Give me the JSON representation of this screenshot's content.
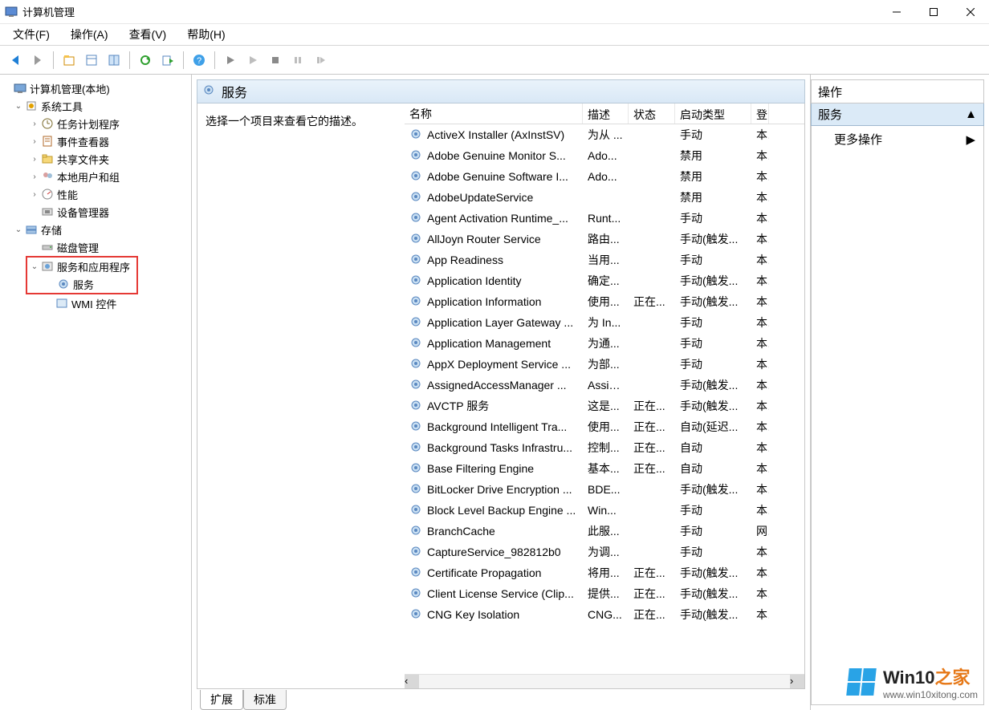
{
  "window": {
    "title": "计算机管理"
  },
  "menu": {
    "file": "文件(F)",
    "action": "操作(A)",
    "view": "查看(V)",
    "help": "帮助(H)"
  },
  "tree": {
    "root": "计算机管理(本地)",
    "system_tools": "系统工具",
    "task_scheduler": "任务计划程序",
    "event_viewer": "事件查看器",
    "shared_folders": "共享文件夹",
    "local_users": "本地用户和组",
    "performance": "性能",
    "device_manager": "设备管理器",
    "storage": "存储",
    "disk_mgmt": "磁盘管理",
    "services_apps": "服务和应用程序",
    "services": "服务",
    "wmi": "WMI 控件"
  },
  "center": {
    "header": "服务",
    "description_prompt": "选择一个项目来查看它的描述。",
    "columns": {
      "name": "名称",
      "desc": "描述",
      "state": "状态",
      "startup": "启动类型",
      "logon": "登"
    },
    "tabs": {
      "extended": "扩展",
      "standard": "标准"
    }
  },
  "services": [
    {
      "name": "ActiveX Installer (AxInstSV)",
      "desc": "为从 ...",
      "state": "",
      "startup": "手动",
      "logon": "本"
    },
    {
      "name": "Adobe Genuine Monitor S...",
      "desc": "Ado...",
      "state": "",
      "startup": "禁用",
      "logon": "本"
    },
    {
      "name": "Adobe Genuine Software I...",
      "desc": "Ado...",
      "state": "",
      "startup": "禁用",
      "logon": "本"
    },
    {
      "name": "AdobeUpdateService",
      "desc": "",
      "state": "",
      "startup": "禁用",
      "logon": "本"
    },
    {
      "name": "Agent Activation Runtime_...",
      "desc": "Runt...",
      "state": "",
      "startup": "手动",
      "logon": "本"
    },
    {
      "name": "AllJoyn Router Service",
      "desc": "路由...",
      "state": "",
      "startup": "手动(触发...",
      "logon": "本"
    },
    {
      "name": "App Readiness",
      "desc": "当用...",
      "state": "",
      "startup": "手动",
      "logon": "本"
    },
    {
      "name": "Application Identity",
      "desc": "确定...",
      "state": "",
      "startup": "手动(触发...",
      "logon": "本"
    },
    {
      "name": "Application Information",
      "desc": "使用...",
      "state": "正在...",
      "startup": "手动(触发...",
      "logon": "本"
    },
    {
      "name": "Application Layer Gateway ...",
      "desc": "为 In...",
      "state": "",
      "startup": "手动",
      "logon": "本"
    },
    {
      "name": "Application Management",
      "desc": "为通...",
      "state": "",
      "startup": "手动",
      "logon": "本"
    },
    {
      "name": "AppX Deployment Service ...",
      "desc": "为部...",
      "state": "",
      "startup": "手动",
      "logon": "本"
    },
    {
      "name": "AssignedAccessManager ...",
      "desc": "Assig...",
      "state": "",
      "startup": "手动(触发...",
      "logon": "本"
    },
    {
      "name": "AVCTP 服务",
      "desc": "这是...",
      "state": "正在...",
      "startup": "手动(触发...",
      "logon": "本"
    },
    {
      "name": "Background Intelligent Tra...",
      "desc": "使用...",
      "state": "正在...",
      "startup": "自动(延迟...",
      "logon": "本"
    },
    {
      "name": "Background Tasks Infrastru...",
      "desc": "控制...",
      "state": "正在...",
      "startup": "自动",
      "logon": "本"
    },
    {
      "name": "Base Filtering Engine",
      "desc": "基本...",
      "state": "正在...",
      "startup": "自动",
      "logon": "本"
    },
    {
      "name": "BitLocker Drive Encryption ...",
      "desc": "BDE...",
      "state": "",
      "startup": "手动(触发...",
      "logon": "本"
    },
    {
      "name": "Block Level Backup Engine ...",
      "desc": "Win...",
      "state": "",
      "startup": "手动",
      "logon": "本"
    },
    {
      "name": "BranchCache",
      "desc": "此服...",
      "state": "",
      "startup": "手动",
      "logon": "网"
    },
    {
      "name": "CaptureService_982812b0",
      "desc": "为调...",
      "state": "",
      "startup": "手动",
      "logon": "本"
    },
    {
      "name": "Certificate Propagation",
      "desc": "将用...",
      "state": "正在...",
      "startup": "手动(触发...",
      "logon": "本"
    },
    {
      "name": "Client License Service (Clip...",
      "desc": "提供...",
      "state": "正在...",
      "startup": "手动(触发...",
      "logon": "本"
    },
    {
      "name": "CNG Key Isolation",
      "desc": "CNG...",
      "state": "正在...",
      "startup": "手动(触发...",
      "logon": "本"
    }
  ],
  "actions": {
    "header": "操作",
    "section": "服务",
    "more": "更多操作"
  },
  "watermark": {
    "brand_main": "Win10",
    "brand_suffix": "之家",
    "url": "www.win10xitong.com"
  }
}
